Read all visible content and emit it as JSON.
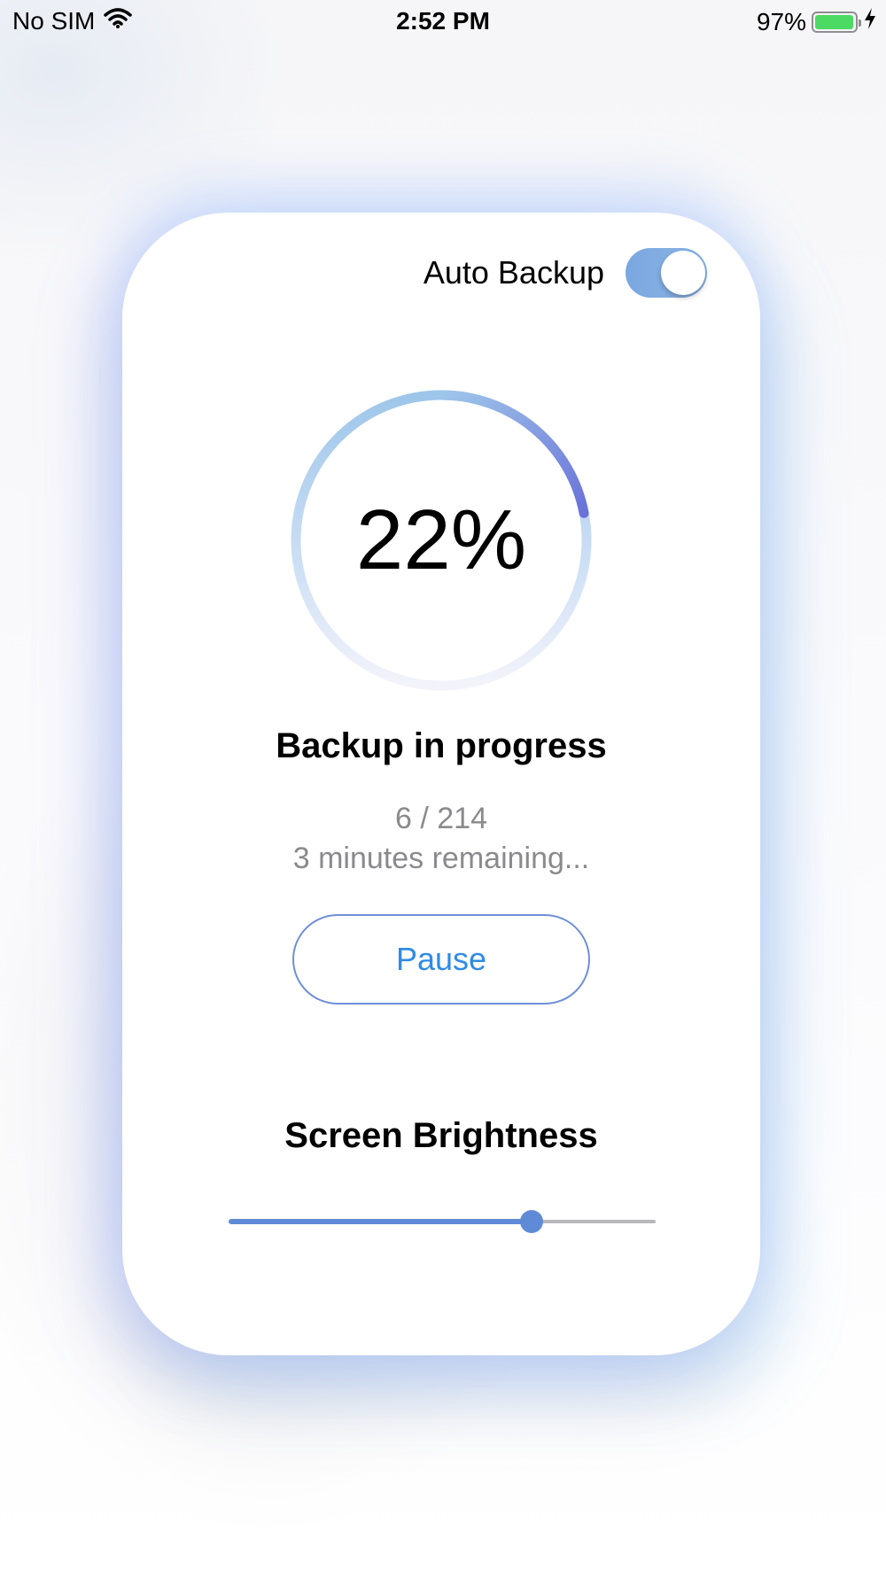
{
  "status_bar": {
    "carrier": "No SIM",
    "time": "2:52 PM",
    "battery_percent_text": "97%",
    "battery_level": 0.97,
    "battery_color": "#4cd964"
  },
  "card": {
    "auto_backup": {
      "label": "Auto Backup",
      "enabled": true
    },
    "progress": {
      "value": 0.22,
      "text": "22%",
      "gradient_start": "#9ec6ea",
      "gradient_end": "#6a72d8"
    },
    "status_title": "Backup in progress",
    "count_text": "6 / 214",
    "remaining_text": "3 minutes remaining...",
    "pause_label": "Pause",
    "brightness": {
      "title": "Screen Brightness",
      "value": 0.71
    }
  },
  "colors": {
    "accent": "#2f8be6",
    "slider": "#5f8ad6",
    "toggle": "#7aa7e0"
  }
}
